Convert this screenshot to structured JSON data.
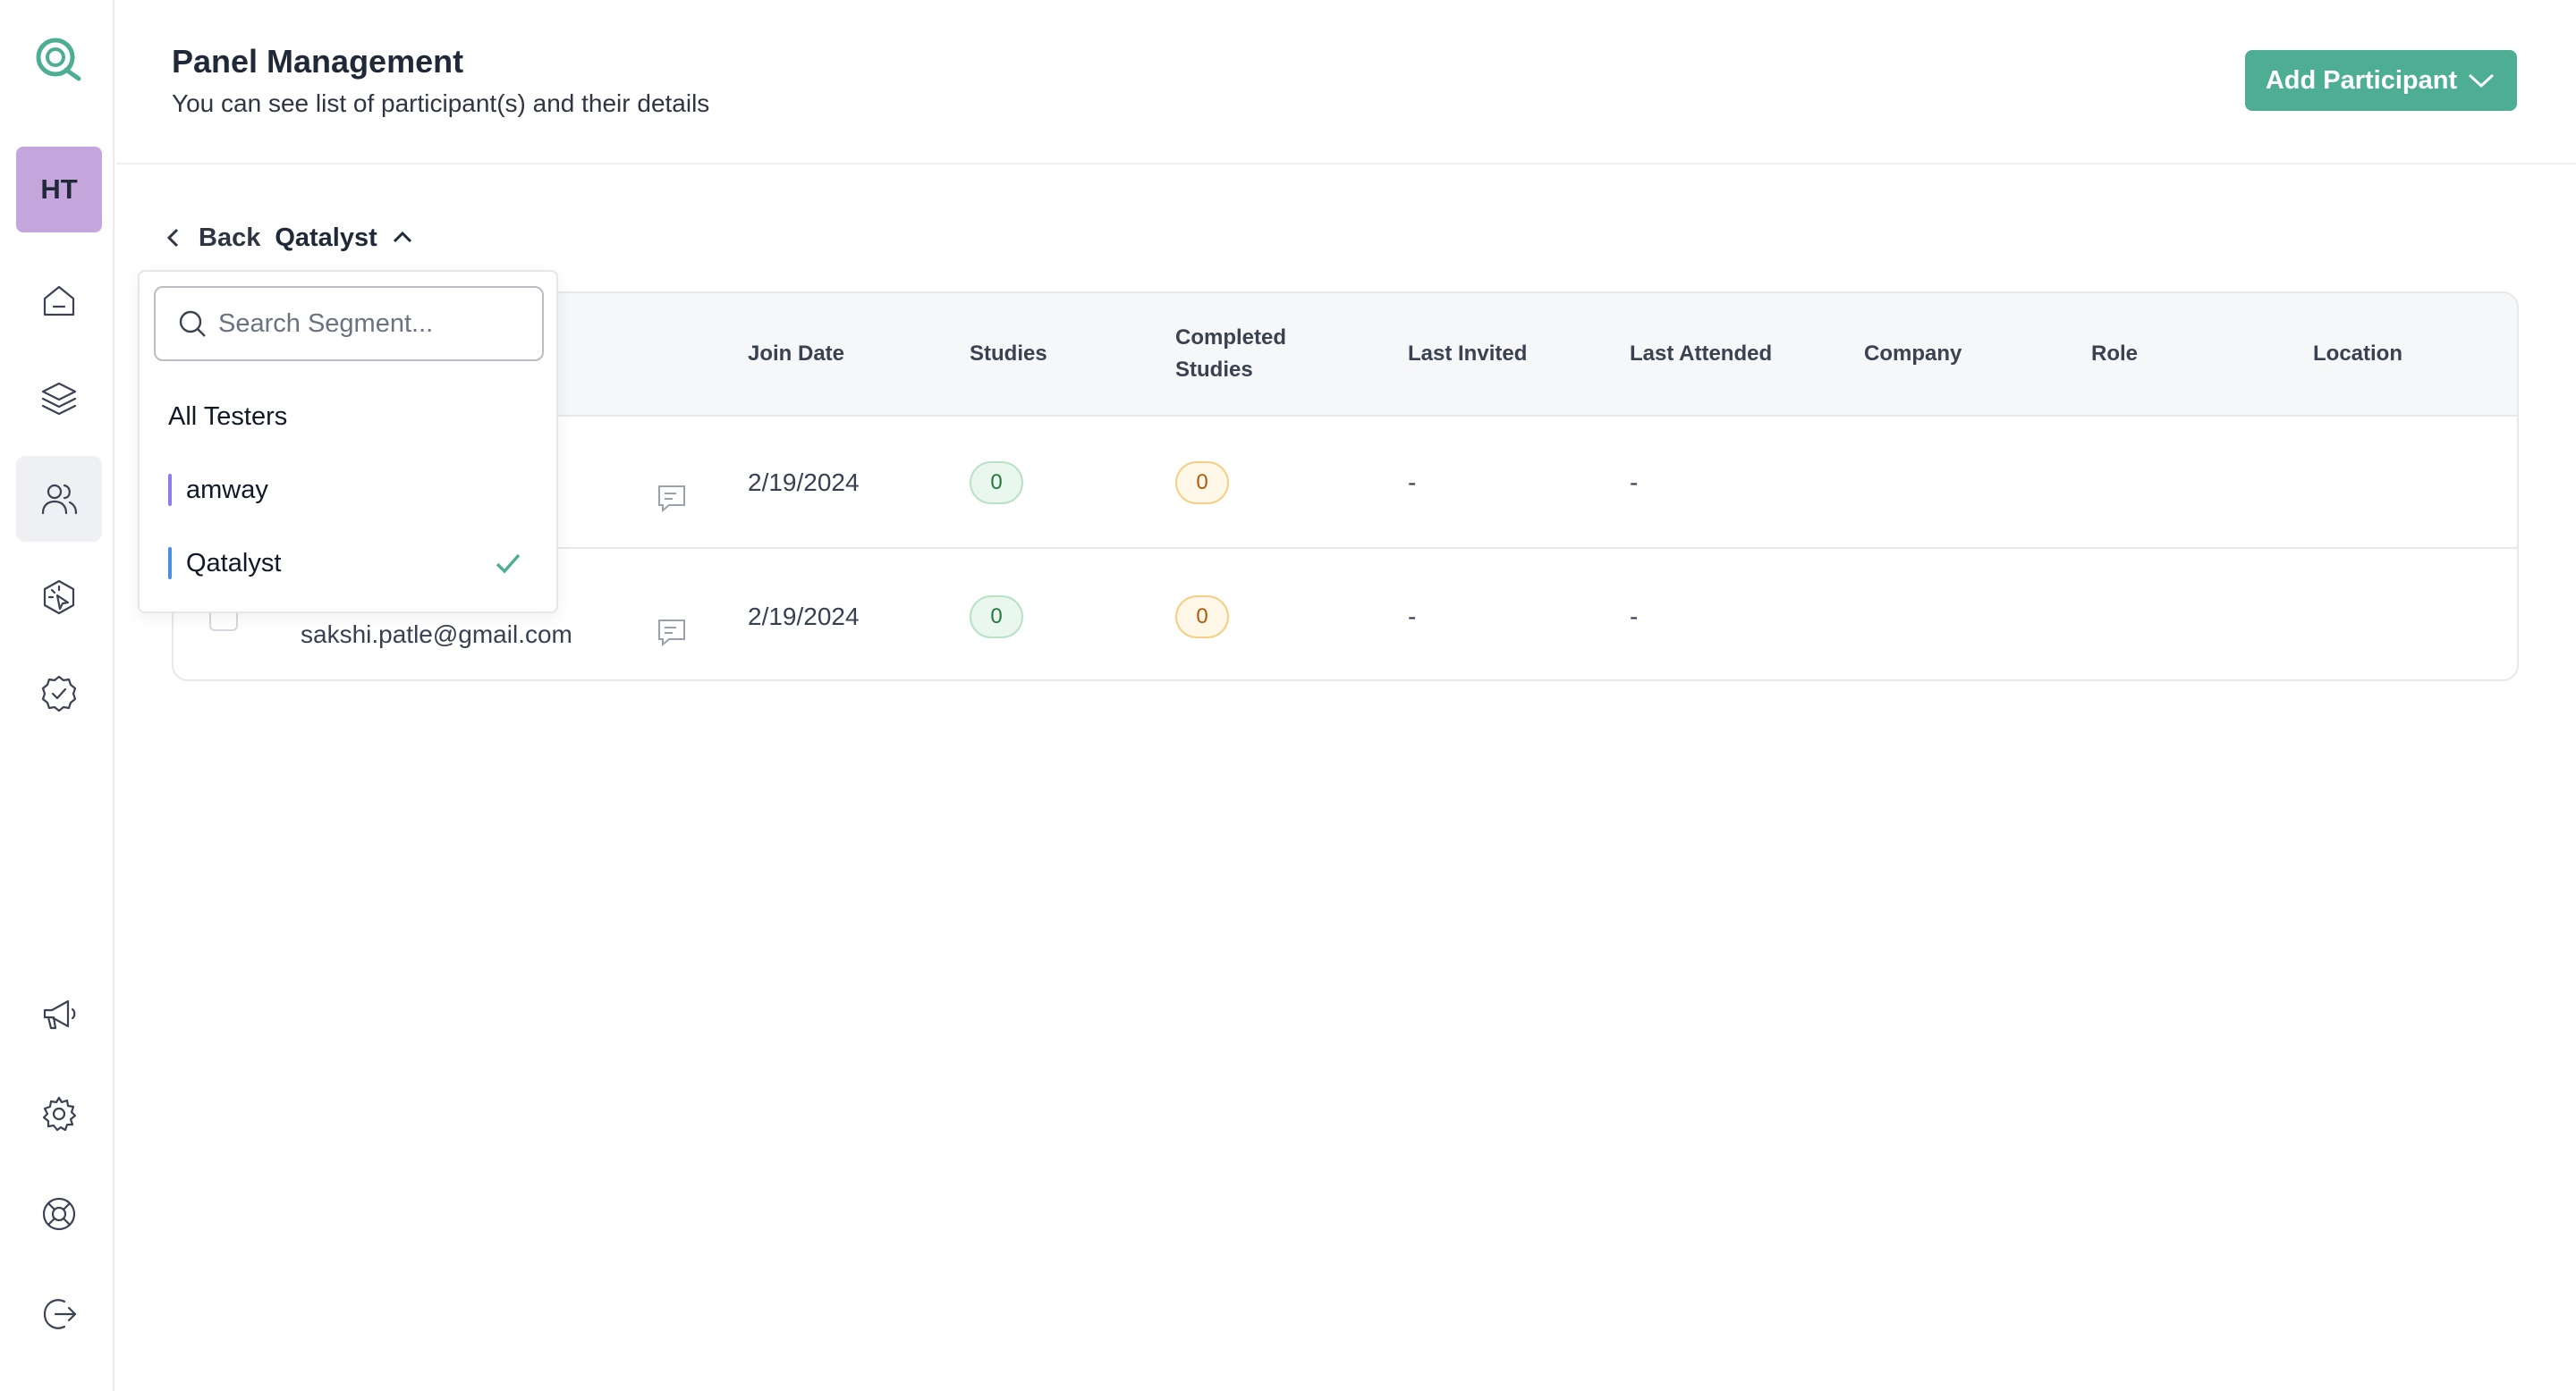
{
  "sidebar": {
    "avatar_initials": "HT",
    "items": [
      {
        "icon": "home-icon"
      },
      {
        "icon": "layers-icon"
      },
      {
        "icon": "users-icon",
        "active": true
      },
      {
        "icon": "target-click-icon"
      },
      {
        "icon": "badge-check-icon"
      },
      {
        "icon": "megaphone-icon"
      },
      {
        "icon": "gear-icon"
      },
      {
        "icon": "lifebuoy-icon"
      },
      {
        "icon": "logout-icon"
      }
    ]
  },
  "header": {
    "title": "Panel Management",
    "subtitle": "You can see list of participant(s) and their details",
    "add_button_label": "Add Participant"
  },
  "nav": {
    "back_label": "Back",
    "segment_label": "Qatalyst"
  },
  "dropdown": {
    "search_placeholder": "Search Segment...",
    "items": [
      {
        "label": "All Testers"
      },
      {
        "label": "amway",
        "color": "#8b7cf0"
      },
      {
        "label": "Qatalyst",
        "color": "#4a90e2",
        "selected": true
      }
    ]
  },
  "table": {
    "columns": {
      "join_date": "Join Date",
      "studies": "Studies",
      "completed_l1": "Completed",
      "completed_l2": "Studies",
      "last_invited": "Last Invited",
      "last_attended": "Last Attended",
      "company": "Company",
      "role": "Role",
      "location": "Location"
    },
    "rows": [
      {
        "email": "",
        "join_date": "2/19/2024",
        "studies": "0",
        "completed": "0",
        "last_invited": "-",
        "last_attended": "-"
      },
      {
        "email": "sakshi.patle@gmail.com",
        "join_date": "2/19/2024",
        "studies": "0",
        "completed": "0",
        "last_invited": "-",
        "last_attended": "-"
      }
    ]
  },
  "colors": {
    "accent": "#4eae93",
    "avatar_bg": "#c4a5dc"
  }
}
